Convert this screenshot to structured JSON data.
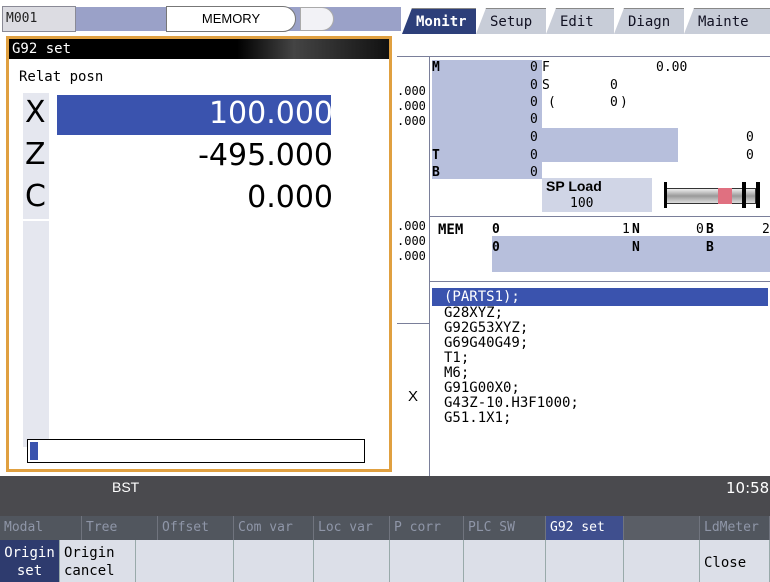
{
  "status": {
    "system_id": "M001",
    "mode": "MEMORY"
  },
  "tabs": [
    {
      "label": "Monitr",
      "active": true
    },
    {
      "label": "Setup"
    },
    {
      "label": "Edit"
    },
    {
      "label": "Diagn"
    },
    {
      "label": "Mainte"
    }
  ],
  "dialog": {
    "title": "G92 set",
    "subtitle": "Relat posn",
    "axes": [
      {
        "label": "X",
        "value": "100.000"
      },
      {
        "label": "Z",
        "value": "-495.000"
      },
      {
        "label": "C",
        "value": "0.000"
      }
    ],
    "input_value": ""
  },
  "coords_partial": [
    ".000",
    ".000",
    ".000",
    ".000",
    ".000",
    ".000"
  ],
  "axis_marker": "X",
  "modal": {
    "M_label": "M",
    "M_value": "0",
    "F_label": "F",
    "F_value": "0.00",
    "S_label": "S",
    "S_value": "0",
    "S_paren_value": "0",
    "r4_value": "0",
    "r4_right": "0",
    "r5_value": "0",
    "r5_right": "0",
    "T_label": "T",
    "T_value": "0",
    "B_label": "B",
    "B_value": "0",
    "spload_label": "SP Load",
    "spload_value": "100"
  },
  "run": {
    "mem": "MEM",
    "o_label": "0",
    "o_value": "1",
    "n_label": "N",
    "n_value": "0",
    "b_label": "B",
    "b_value": "2",
    "o2": "0",
    "n2": "N",
    "b2": "B"
  },
  "program": [
    "(PARTS1);",
    "G28XYZ;",
    "G92G53XYZ;",
    "G69G40G49;",
    "T1;",
    "M6;",
    "G91G00X0;",
    "G43Z-10.H3F1000;",
    "G51.1X1;"
  ],
  "bottom": {
    "status": "BST",
    "clock": "10:58"
  },
  "menu_top": [
    "Modal",
    "Tree",
    "Offset",
    "Com var",
    "Loc var",
    "P corr",
    "PLC SW",
    "G92 set",
    "",
    "LdMeter"
  ],
  "menu_bottom": {
    "origin_set": "Origin set",
    "origin_cancel": "Origin cancel",
    "close": "Close"
  },
  "colors": {
    "accent": "#3a53ae",
    "highlight_border": "#e0a040",
    "active_tab": "#2d3f7a"
  }
}
